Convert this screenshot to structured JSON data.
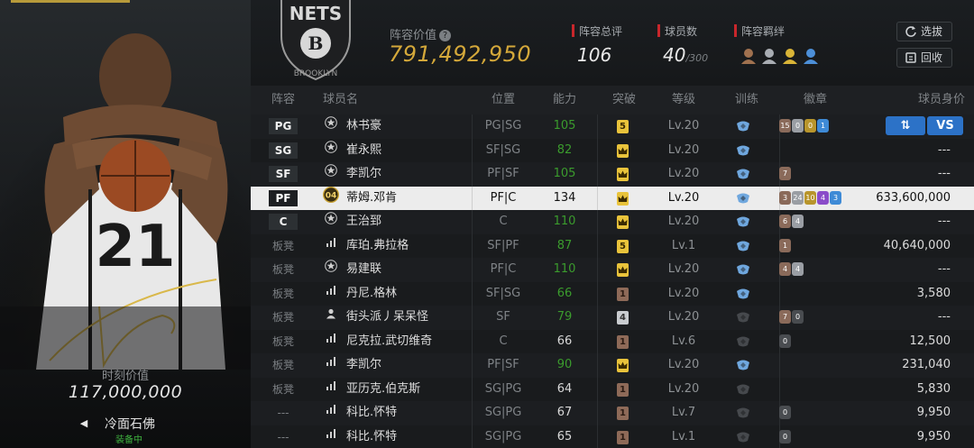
{
  "left_card": {
    "value_label": "时刻价值",
    "value": "117,000,000",
    "card_name": "冷面石佛",
    "card_status": "装备中",
    "jersey_number": "21"
  },
  "header": {
    "team_logo_text": "NETS",
    "team_name_partial": "BROOKLYN",
    "lineup_value_label": "阵容价值",
    "lineup_value": "791,492,950",
    "stats": [
      {
        "label": "阵容总评",
        "value": "106",
        "sub": ""
      },
      {
        "label": "球员数",
        "value": "40",
        "sub": "/300"
      },
      {
        "label": "阵容羁绊",
        "value": "",
        "sub": ""
      }
    ],
    "buttons": {
      "select_label": "选拔",
      "recycle_label": "回收"
    }
  },
  "table": {
    "columns": [
      "阵容",
      "球员名",
      "位置",
      "能力",
      "突破",
      "等级",
      "训练",
      "徽章",
      "球员身价"
    ],
    "rows": [
      {
        "slot": "PG",
        "starter": true,
        "icon": "star-icon",
        "name": "林书豪",
        "pos": "PG|SG",
        "ability": "105",
        "green": true,
        "breakthrough": "5",
        "bk": "gold",
        "level": "Lv.20",
        "train": "blue",
        "badges": [
          {
            "t": "15",
            "c": "bronze"
          },
          {
            "t": "0",
            "c": "silver"
          },
          {
            "t": "0",
            "c": "gold"
          },
          {
            "t": "1",
            "c": "blue"
          }
        ],
        "worth": "",
        "actions": true
      },
      {
        "slot": "SG",
        "starter": true,
        "icon": "star-icon",
        "name": "崔永熙",
        "pos": "SF|SG",
        "ability": "82",
        "green": true,
        "breakthrough": "",
        "bk": "gold",
        "level": "Lv.20",
        "train": "blue",
        "badges": [],
        "worth": "---"
      },
      {
        "slot": "SF",
        "starter": true,
        "icon": "star-icon",
        "name": "李凯尔",
        "pos": "PF|SF",
        "ability": "105",
        "green": true,
        "breakthrough": "",
        "bk": "gold",
        "level": "Lv.20",
        "train": "blue",
        "badges": [
          {
            "t": "7",
            "c": "bronze"
          }
        ],
        "worth": "---"
      },
      {
        "slot": "PF",
        "starter": true,
        "selected": true,
        "icon": "badge-04-icon",
        "name": "蒂姆.邓肯",
        "pos": "PF|C",
        "ability": "134",
        "green": false,
        "breakthrough": "",
        "bk": "gold",
        "level": "Lv.20",
        "train": "blue",
        "badges": [
          {
            "t": "3",
            "c": "bronze"
          },
          {
            "t": "24",
            "c": "silver"
          },
          {
            "t": "10",
            "c": "gold"
          },
          {
            "t": "4",
            "c": "purple"
          },
          {
            "t": "3",
            "c": "blue"
          }
        ],
        "worth": "633,600,000"
      },
      {
        "slot": "C",
        "starter": true,
        "icon": "star-icon",
        "name": "王治郅",
        "pos": "C",
        "ability": "110",
        "green": true,
        "breakthrough": "",
        "bk": "gold",
        "level": "Lv.20",
        "train": "blue",
        "badges": [
          {
            "t": "6",
            "c": "bronze"
          },
          {
            "t": "4",
            "c": "silver"
          }
        ],
        "worth": "---"
      },
      {
        "slot": "板凳",
        "starter": false,
        "icon": "bars-icon",
        "name": "库珀.弗拉格",
        "pos": "SF|PF",
        "ability": "87",
        "green": true,
        "breakthrough": "5",
        "bk": "gold",
        "level": "Lv.1",
        "train": "blue",
        "badges": [
          {
            "t": "1",
            "c": "bronze"
          }
        ],
        "worth": "40,640,000"
      },
      {
        "slot": "板凳",
        "starter": false,
        "icon": "star-icon",
        "name": "易建联",
        "pos": "PF|C",
        "ability": "110",
        "green": true,
        "breakthrough": "",
        "bk": "gold",
        "level": "Lv.20",
        "train": "blue",
        "badges": [
          {
            "t": "4",
            "c": "bronze"
          },
          {
            "t": "4",
            "c": "silver"
          }
        ],
        "worth": "---"
      },
      {
        "slot": "板凳",
        "starter": false,
        "icon": "bars-icon",
        "name": "丹尼.格林",
        "pos": "SF|SG",
        "ability": "66",
        "green": true,
        "breakthrough": "1",
        "bk": "bronze",
        "level": "Lv.20",
        "train": "blue",
        "badges": [],
        "worth": "3,580"
      },
      {
        "slot": "板凳",
        "starter": false,
        "icon": "person-icon",
        "name": "街头派丿呆呆怪",
        "pos": "SF",
        "ability": "79",
        "green": true,
        "breakthrough": "4",
        "bk": "silver",
        "level": "Lv.20",
        "train": "gray",
        "badges": [
          {
            "t": "7",
            "c": "bronze"
          },
          {
            "t": "0",
            "c": "dark"
          }
        ],
        "worth": "---"
      },
      {
        "slot": "板凳",
        "starter": false,
        "icon": "bars-icon",
        "name": "尼克拉.武切维奇",
        "pos": "C",
        "ability": "66",
        "green": false,
        "breakthrough": "1",
        "bk": "bronze",
        "level": "Lv.6",
        "train": "gray",
        "badges": [
          {
            "t": "0",
            "c": "dark"
          }
        ],
        "worth": "12,500"
      },
      {
        "slot": "板凳",
        "starter": false,
        "icon": "bars-icon",
        "name": "李凯尔",
        "pos": "PF|SF",
        "ability": "90",
        "green": true,
        "breakthrough": "",
        "bk": "gold",
        "level": "Lv.20",
        "train": "blue",
        "badges": [],
        "worth": "231,040"
      },
      {
        "slot": "板凳",
        "starter": false,
        "icon": "bars-icon",
        "name": "亚历克.伯克斯",
        "pos": "SG|PG",
        "ability": "64",
        "green": false,
        "breakthrough": "1",
        "bk": "bronze",
        "level": "Lv.20",
        "train": "gray",
        "badges": [],
        "worth": "5,830"
      },
      {
        "slot": "---",
        "starter": false,
        "icon": "bars-icon",
        "name": "科比.怀特",
        "pos": "SG|PG",
        "ability": "67",
        "green": false,
        "breakthrough": "1",
        "bk": "bronze",
        "level": "Lv.7",
        "train": "gray",
        "badges": [
          {
            "t": "0",
            "c": "dark"
          }
        ],
        "worth": "9,950"
      },
      {
        "slot": "---",
        "starter": false,
        "icon": "bars-icon",
        "name": "科比.怀特",
        "pos": "SG|PG",
        "ability": "65",
        "green": false,
        "breakthrough": "1",
        "bk": "bronze",
        "level": "Lv.1",
        "train": "gray",
        "badges": [
          {
            "t": "0",
            "c": "dark"
          }
        ],
        "worth": "9,950"
      }
    ]
  }
}
